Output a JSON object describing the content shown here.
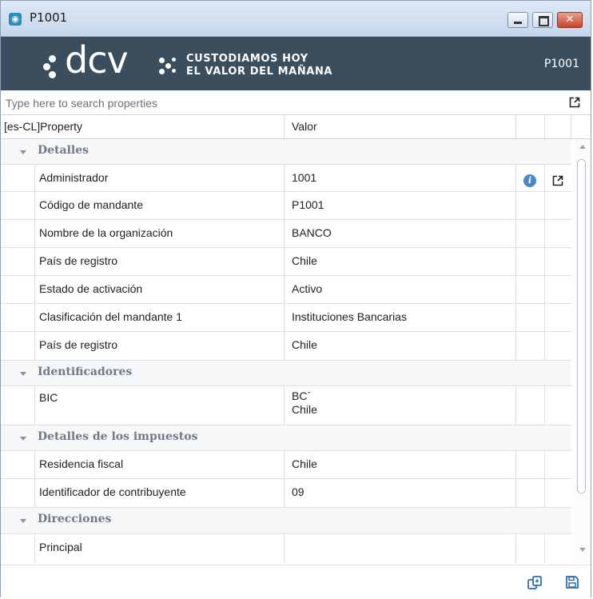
{
  "window": {
    "title": "P1001"
  },
  "banner": {
    "logo": "dcv",
    "tagline_line1": "CUSTODIAMOS HOY",
    "tagline_line2": "EL VALOR DEL MAÑANA",
    "code": "P1001"
  },
  "search": {
    "placeholder": "Type here to search properties",
    "value": ""
  },
  "grid": {
    "columns": [
      "[es-CL]Property",
      "Valor"
    ],
    "groups": [
      {
        "label": "Detalles",
        "rows": [
          {
            "property": "Administrador",
            "value": "1001"
          },
          {
            "property": "Código de mandante",
            "value": "P1001"
          },
          {
            "property": "Nombre de la organización",
            "value": "BANCO"
          },
          {
            "property": "País de registro",
            "value": "Chile"
          },
          {
            "property": "Estado de activación",
            "value": "Activo"
          },
          {
            "property": "Clasificación del mandante 1",
            "value": "Instituciones Bancarias"
          },
          {
            "property": "País de registro",
            "value": "Chile"
          }
        ]
      },
      {
        "label": "Identificadores",
        "rows": [
          {
            "property": "BIC",
            "value_line1": "BC`",
            "value_line2": "Chile"
          }
        ]
      },
      {
        "label": "Detalles de los impuestos",
        "rows": [
          {
            "property": "Residencia fiscal",
            "value": "Chile"
          },
          {
            "property": "Identificador de contribuyente",
            "value": "09"
          }
        ]
      },
      {
        "label": "Direcciones",
        "rows": [
          {
            "property": "Principal",
            "value": ""
          }
        ]
      }
    ]
  },
  "icons": {
    "app": "app-icon",
    "info": "info-icon",
    "open_external": "open-external-icon",
    "copy": "copy-icon",
    "save": "save-icon"
  },
  "colors": {
    "banner": "#3a4e5e",
    "group_label": "#6f7a86",
    "info": "#4a86c9"
  }
}
